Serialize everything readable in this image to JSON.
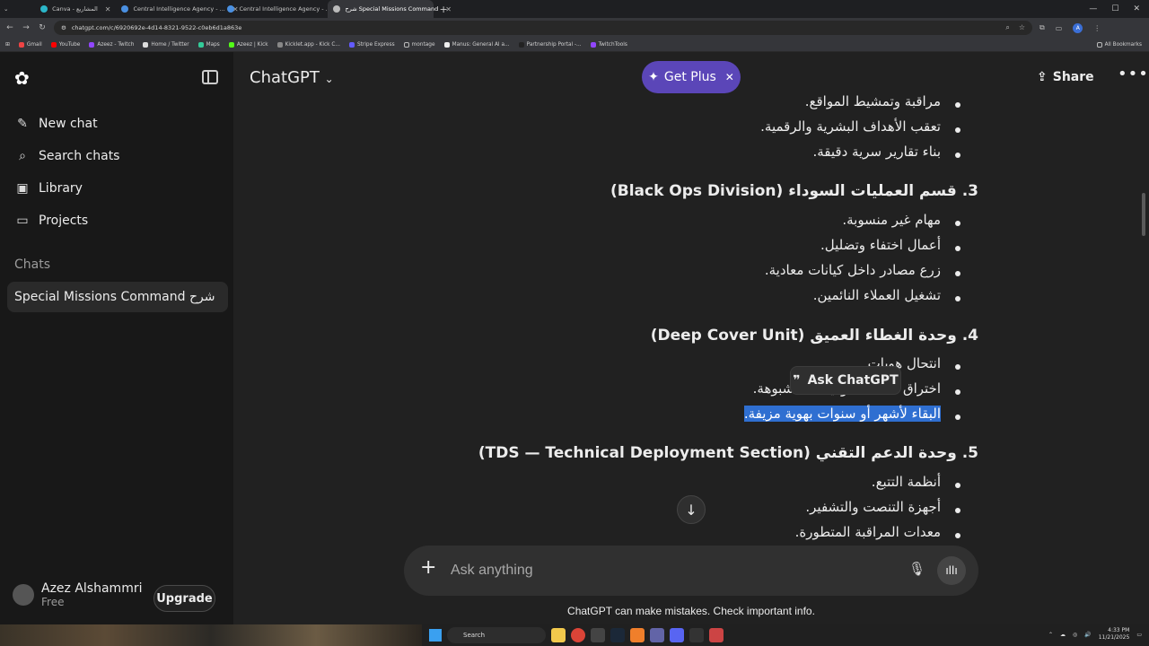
{
  "browser": {
    "tabs": [
      {
        "label": "Canva - المشاريع",
        "active": false
      },
      {
        "label": "Central Intelligence Agency - ...",
        "active": false
      },
      {
        "label": "Central Intelligence Agency - ...",
        "active": false
      },
      {
        "label": "شرح Special Missions Command",
        "active": true
      }
    ],
    "url": "chatgpt.com/c/6920692e-4d14-8321-9522-c0eb6d1a863e",
    "bookmarks": [
      "Gmail",
      "YouTube",
      "Azeez - Twitch",
      "Home / Twitter",
      "Maps",
      "Azeez | Kick",
      "Kicklet.app - Kick C...",
      "Stripe Express",
      "montage",
      "Manus: General AI a...",
      "Partnership Portal -...",
      "TwitchTools"
    ],
    "all_bookmarks": "All Bookmarks",
    "profile_initial": "A"
  },
  "sidebar": {
    "items": [
      {
        "label": "New chat",
        "icon": "edit-icon"
      },
      {
        "label": "Search chats",
        "icon": "search-icon"
      },
      {
        "label": "Library",
        "icon": "library-icon"
      },
      {
        "label": "Projects",
        "icon": "folder-icon"
      }
    ],
    "chats_heading": "Chats",
    "chats": [
      "Special Missions Command شرح"
    ],
    "user": {
      "name": "Azez Alshammri",
      "plan": "Free"
    },
    "upgrade_label": "Upgrade"
  },
  "header": {
    "model": "ChatGPT",
    "get_plus": "Get Plus",
    "share": "Share"
  },
  "content": {
    "lines": [
      {
        "kind": "li",
        "text": "مراقبة وتمشيط المواقع."
      },
      {
        "kind": "li",
        "text": "تعقب الأهداف البشرية والرقمية."
      },
      {
        "kind": "li",
        "text": "بناء تقارير سرية دقيقة."
      },
      {
        "kind": "h",
        "text": "3. قسم العمليات السوداء (Black Ops Division)"
      },
      {
        "kind": "li",
        "text": "مهام غير منسوبة."
      },
      {
        "kind": "li",
        "text": "أعمال اختفاء وتضليل."
      },
      {
        "kind": "li",
        "text": "زرع مصادر داخل كيانات معادية."
      },
      {
        "kind": "li",
        "text": "تشغيل العملاء النائمين."
      },
      {
        "kind": "h",
        "text": "4. وحدة الغطاء العميق (Deep Cover Unit)"
      },
      {
        "kind": "li",
        "text": "انتحال هويات."
      },
      {
        "kind": "li",
        "text": "اختراق منظمات وكيانات مشبوهة."
      },
      {
        "kind": "li",
        "text": "البقاء لأشهر أو سنوات بهوية مزيفة.",
        "highlight": true
      },
      {
        "kind": "h",
        "text": "5. وحدة الدعم التقني (TDS — Technical Deployment Section)"
      },
      {
        "kind": "li",
        "text": "أنظمة التتبع."
      },
      {
        "kind": "li",
        "text": "أجهزة التنصت والتشفير."
      },
      {
        "kind": "li",
        "text": "معدات المراقبة المتطورة."
      }
    ],
    "ask_chatgpt": "Ask ChatGPT"
  },
  "composer": {
    "placeholder": "Ask anything",
    "disclaimer": "ChatGPT can make mistakes. Check important info."
  },
  "taskbar": {
    "search": "Search",
    "time": "4:33 PM",
    "date": "11/21/2025"
  }
}
